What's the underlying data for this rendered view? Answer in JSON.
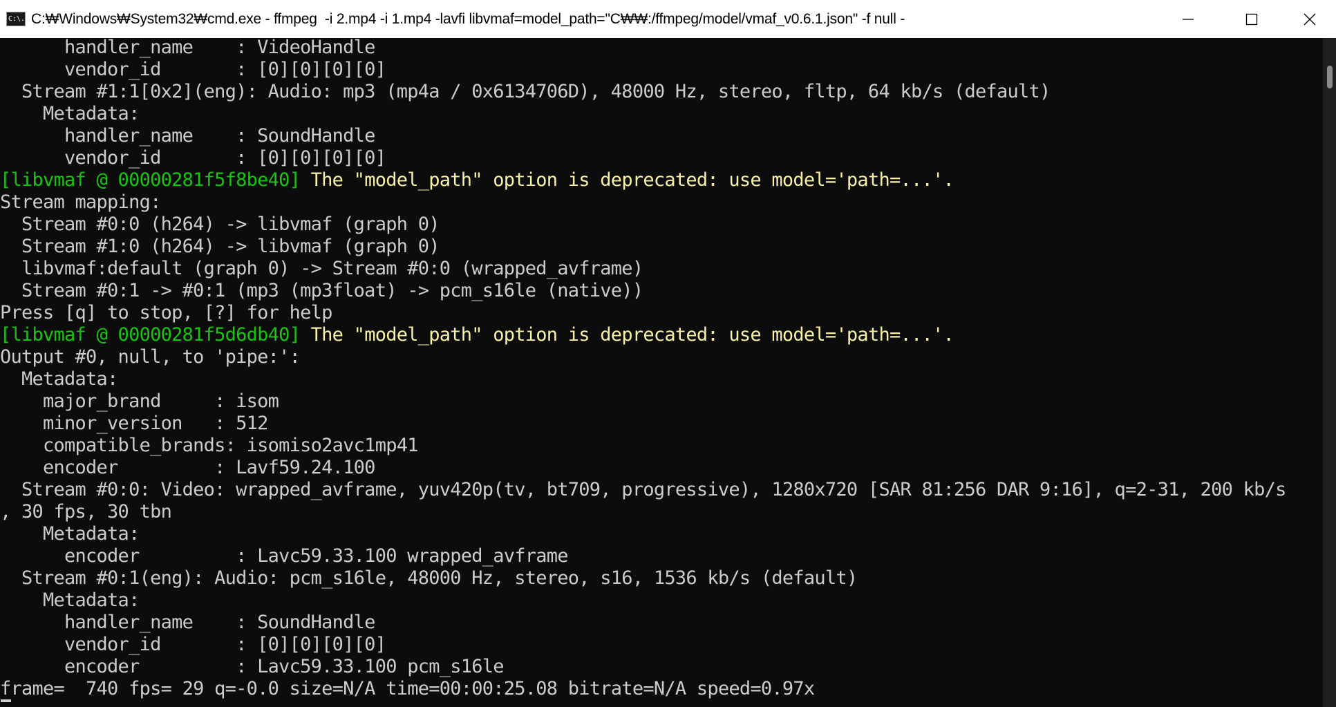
{
  "window": {
    "title": "C:₩Windows₩System32₩cmd.exe - ffmpeg  -i 2.mp4 -i 1.mp4 -lavfi libvmaf=model_path=\"C₩₩:/ffmpeg/model/vmaf_v0.6.1.json\" -f null -",
    "icon_label": "C:\\.",
    "controls": [
      "minimize-icon",
      "maximize-icon",
      "close-icon"
    ]
  },
  "colors": {
    "background": "#0c0c0c",
    "text": "#cccccc",
    "green": "#16c60c",
    "yellow": "#f9f1a5"
  },
  "console": {
    "lines": [
      {
        "text": "      handler_name    : VideoHandle"
      },
      {
        "text": "      vendor_id       : [0][0][0][0]"
      },
      {
        "text": "  Stream #1:1[0x2](eng): Audio: mp3 (mp4a / 0x6134706D), 48000 Hz, stereo, fltp, 64 kb/s (default)"
      },
      {
        "text": "    Metadata:"
      },
      {
        "text": "      handler_name    : SoundHandle"
      },
      {
        "text": "      vendor_id       : [0][0][0][0]"
      },
      {
        "prefix": "[libvmaf @ 00000281f5f8be40]",
        "text": " The \"model_path\" option is deprecated: use model='path=...'."
      },
      {
        "text": "Stream mapping:"
      },
      {
        "text": "  Stream #0:0 (h264) -> libvmaf (graph 0)"
      },
      {
        "text": "  Stream #1:0 (h264) -> libvmaf (graph 0)"
      },
      {
        "text": "  libvmaf:default (graph 0) -> Stream #0:0 (wrapped_avframe)"
      },
      {
        "text": "  Stream #0:1 -> #0:1 (mp3 (mp3float) -> pcm_s16le (native))"
      },
      {
        "text": "Press [q] to stop, [?] for help"
      },
      {
        "prefix": "[libvmaf @ 00000281f5d6db40]",
        "text": " The \"model_path\" option is deprecated: use model='path=...'."
      },
      {
        "text": "Output #0, null, to 'pipe:':"
      },
      {
        "text": "  Metadata:"
      },
      {
        "text": "    major_brand     : isom"
      },
      {
        "text": "    minor_version   : 512"
      },
      {
        "text": "    compatible_brands: isomiso2avc1mp41"
      },
      {
        "text": "    encoder         : Lavf59.24.100"
      },
      {
        "text": "  Stream #0:0: Video: wrapped_avframe, yuv420p(tv, bt709, progressive), 1280x720 [SAR 81:256 DAR 9:16], q=2-31, 200 kb/s"
      },
      {
        "text": ", 30 fps, 30 tbn"
      },
      {
        "text": "    Metadata:"
      },
      {
        "text": "      encoder         : Lavc59.33.100 wrapped_avframe"
      },
      {
        "text": "  Stream #0:1(eng): Audio: pcm_s16le, 48000 Hz, stereo, s16, 1536 kb/s (default)"
      },
      {
        "text": "    Metadata:"
      },
      {
        "text": "      handler_name    : SoundHandle"
      },
      {
        "text": "      vendor_id       : [0][0][0][0]"
      },
      {
        "text": "      encoder         : Lavc59.33.100 pcm_s16le"
      },
      {
        "text": "frame=  740 fps= 29 q=-0.0 size=N/A time=00:00:25.08 bitrate=N/A speed=0.97x"
      }
    ]
  }
}
